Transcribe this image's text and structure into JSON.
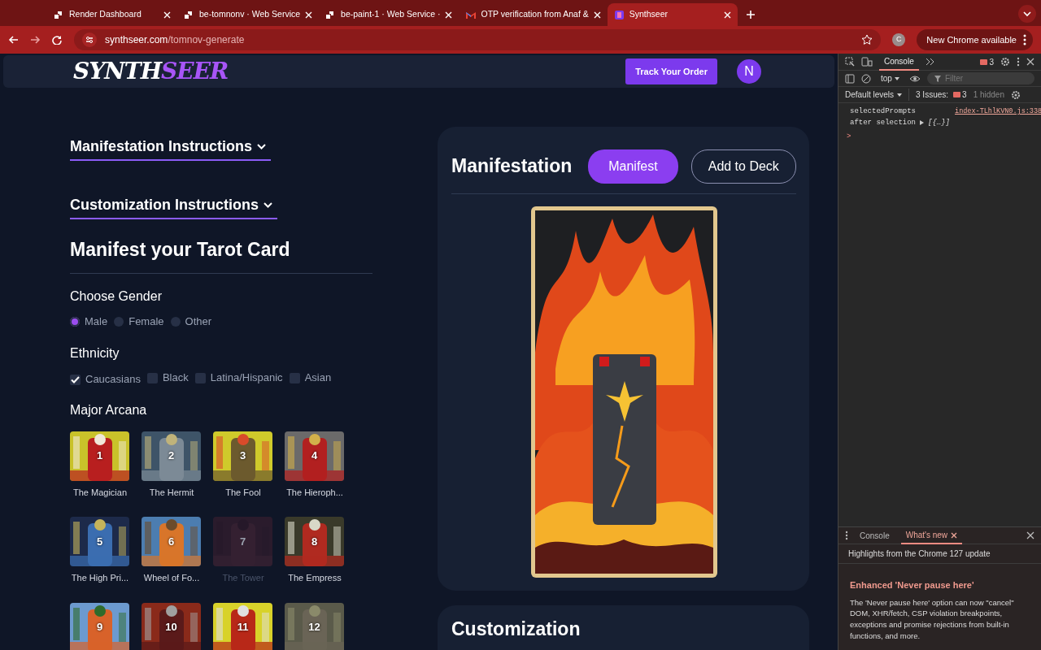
{
  "browser": {
    "tabs": [
      {
        "title": "Render Dashboard",
        "kind": "render",
        "selected": false
      },
      {
        "title": "be-tomnonv · Web Service",
        "kind": "render",
        "selected": false
      },
      {
        "title": "be-paint-1 · Web Service ·",
        "kind": "render",
        "selected": false
      },
      {
        "title": "OTP verification from Anaf &",
        "kind": "mail",
        "selected": false
      },
      {
        "title": "Synthseer",
        "kind": "site",
        "selected": true
      }
    ],
    "url_host": "synthseer.com",
    "url_path": "/tomnov-generate",
    "profile": "C",
    "update_button": "New Chrome available"
  },
  "page": {
    "logo": {
      "part_1": "SYNTH",
      "part_2": "SEER"
    },
    "track_button": "Track Your Order",
    "avatar": "N",
    "accordions": [
      {
        "label": "Manifestation Instructions"
      },
      {
        "label": "Customization Instructions"
      }
    ],
    "form_title": "Manifest your Tarot Card",
    "gender": {
      "label": "Choose Gender",
      "options": [
        {
          "label": "Male",
          "selected": true
        },
        {
          "label": "Female",
          "selected": false
        },
        {
          "label": "Other",
          "selected": false
        }
      ]
    },
    "ethnicity": {
      "label": "Ethnicity",
      "options": [
        {
          "label": "Caucasians",
          "checked": true
        },
        {
          "label": "Black",
          "checked": false
        },
        {
          "label": "Latina/Hispanic",
          "checked": false
        },
        {
          "label": "Asian",
          "checked": false
        }
      ]
    },
    "arcana": {
      "label": "Major Arcana",
      "cards": [
        {
          "number": "1",
          "name": "The Magician",
          "disabled": false
        },
        {
          "number": "2",
          "name": "The Hermit",
          "disabled": false
        },
        {
          "number": "3",
          "name": "The Fool",
          "disabled": false
        },
        {
          "number": "4",
          "name": "The Hieroph...",
          "disabled": false
        },
        {
          "number": "5",
          "name": "The High Pri...",
          "disabled": false
        },
        {
          "number": "6",
          "name": "Wheel of Fo...",
          "disabled": false
        },
        {
          "number": "7",
          "name": "The Tower",
          "disabled": true
        },
        {
          "number": "8",
          "name": "The Empress",
          "disabled": false
        },
        {
          "number": "9",
          "disabled": false
        },
        {
          "number": "10",
          "disabled": false
        },
        {
          "number": "11",
          "disabled": false
        },
        {
          "number": "12",
          "disabled": false
        }
      ]
    },
    "manifestation": {
      "title": "Manifestation",
      "buttons": [
        {
          "label": "Manifest",
          "kind": "primary"
        },
        {
          "label": "Add to Deck",
          "kind": "outline"
        }
      ]
    },
    "customization": {
      "title": "Customization"
    }
  },
  "devtools": {
    "tabs": [
      {
        "label": "Console",
        "selected": true
      }
    ],
    "issues_count": "3",
    "context": "top",
    "filter_placeholder": "Filter",
    "levels": "Default levels",
    "issues_label": "3 Issues:",
    "issues_badge": "3",
    "hidden": "1 hidden",
    "log": {
      "line_1": "selectedPrompts",
      "line_2": "after selection",
      "value": "[{…}]",
      "source": "index-TLhlKVN0.js:338"
    },
    "prompt": ">",
    "drawer": {
      "tabs": [
        {
          "label": "Console",
          "selected": false
        },
        {
          "label": "What's new",
          "selected": true
        }
      ],
      "subtitle": "Highlights from the Chrome 127 update",
      "heading": "Enhanced 'Never pause here'",
      "body": "The 'Never pause here' option can now \"cancel\" DOM, XHR/fetch, CSP violation breakpoints, exceptions and promise rejections from built-in functions, and more."
    }
  }
}
